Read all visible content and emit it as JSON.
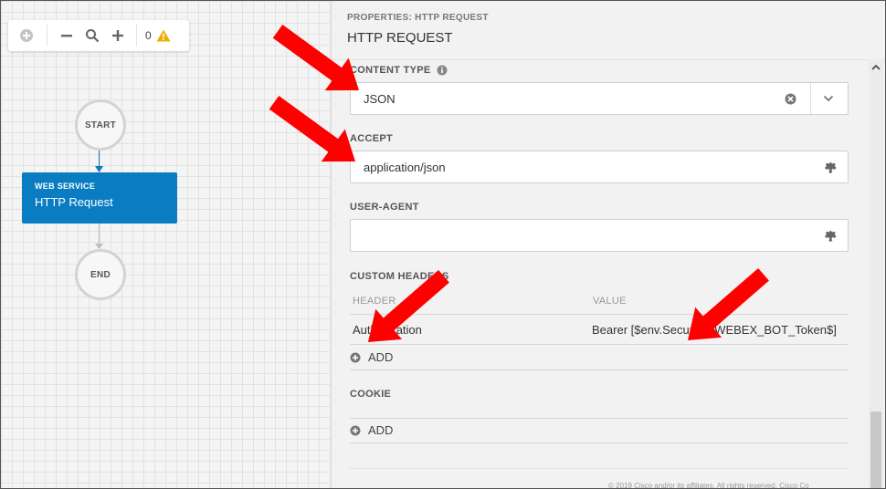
{
  "toolbar": {
    "warning_count": "0",
    "colors": {
      "warning": "#f0ad00",
      "icons": "#666666"
    }
  },
  "workflow": {
    "start_label": "START",
    "end_label": "END",
    "activity": {
      "type_label": "WEB SERVICE",
      "name": "HTTP Request",
      "color": "#0a7dc2"
    }
  },
  "properties": {
    "subtitle": "PROPERTIES: HTTP REQUEST",
    "title": "HTTP REQUEST",
    "content_type": {
      "label": "CONTENT TYPE",
      "value": "JSON",
      "info_icon": "info-icon"
    },
    "accept": {
      "label": "ACCEPT",
      "value": "application/json"
    },
    "user_agent": {
      "label": "USER-AGENT",
      "value": ""
    },
    "custom_headers": {
      "label": "CUSTOM HEADERS",
      "columns": [
        "HEADER",
        "VALUE"
      ],
      "rows": [
        {
          "header": "Authorization",
          "value": "Bearer [$env.SecureX_WEBEX_BOT_Token$]"
        }
      ],
      "add_label": "ADD"
    },
    "cookie": {
      "label": "COOKIE",
      "add_label": "ADD"
    }
  },
  "footer_note": "© 2019 Cisco and/or its affiliates. All rights reserved.  Cisco Co",
  "annotation_color": "#ff0000"
}
